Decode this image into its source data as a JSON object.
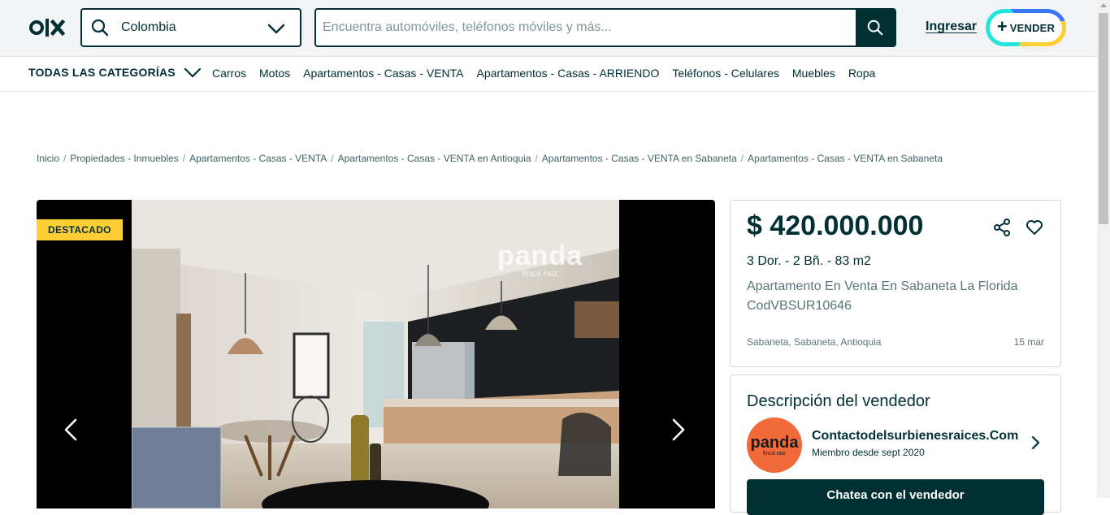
{
  "header": {
    "logo_text": "OLX",
    "location_value": "Colombia",
    "search_placeholder": "Encuentra automóviles, teléfonos móviles y más...",
    "login_label": "Ingresar",
    "sell_label": "VENDER"
  },
  "catnav": {
    "all_categories_label": "TODAS LAS CATEGORÍAS",
    "links": [
      "Carros",
      "Motos",
      "Apartamentos - Casas - VENTA",
      "Apartamentos - Casas - ARRIENDO",
      "Teléfonos - Celulares",
      "Muebles",
      "Ropa"
    ]
  },
  "breadcrumb": [
    "Inicio",
    "Propiedades - Inmuebles",
    "Apartamentos - Casas - VENTA",
    "Apartamentos - Casas - VENTA en Antioquia",
    "Apartamentos - Casas - VENTA en Sabaneta",
    "Apartamentos - Casas - VENTA en Sabaneta"
  ],
  "gallery": {
    "badge": "DESTACADO",
    "watermark_text": "panda",
    "watermark_sub": "finca raiz"
  },
  "listing": {
    "price": "$ 420.000.000",
    "specs": "3 Dor. - 2 Bñ. - 83 m2",
    "title": "Apartamento En Venta En Sabaneta La Florida CodVBSUR10646",
    "location": "Sabaneta, Sabaneta, Antioquia",
    "date": "15 mar"
  },
  "seller": {
    "heading": "Descripción del vendedor",
    "name": "Contactodelsurbienesraices.Com",
    "member_since": "Miembro desde sept 2020",
    "chat_label": "Chatea con el vendedor",
    "avatar_text": "panda",
    "avatar_sub": "finca raiz"
  },
  "colors": {
    "brand_dark": "#002f34",
    "badge_yellow": "#ffce32",
    "avatar_orange": "#f26a3a"
  }
}
